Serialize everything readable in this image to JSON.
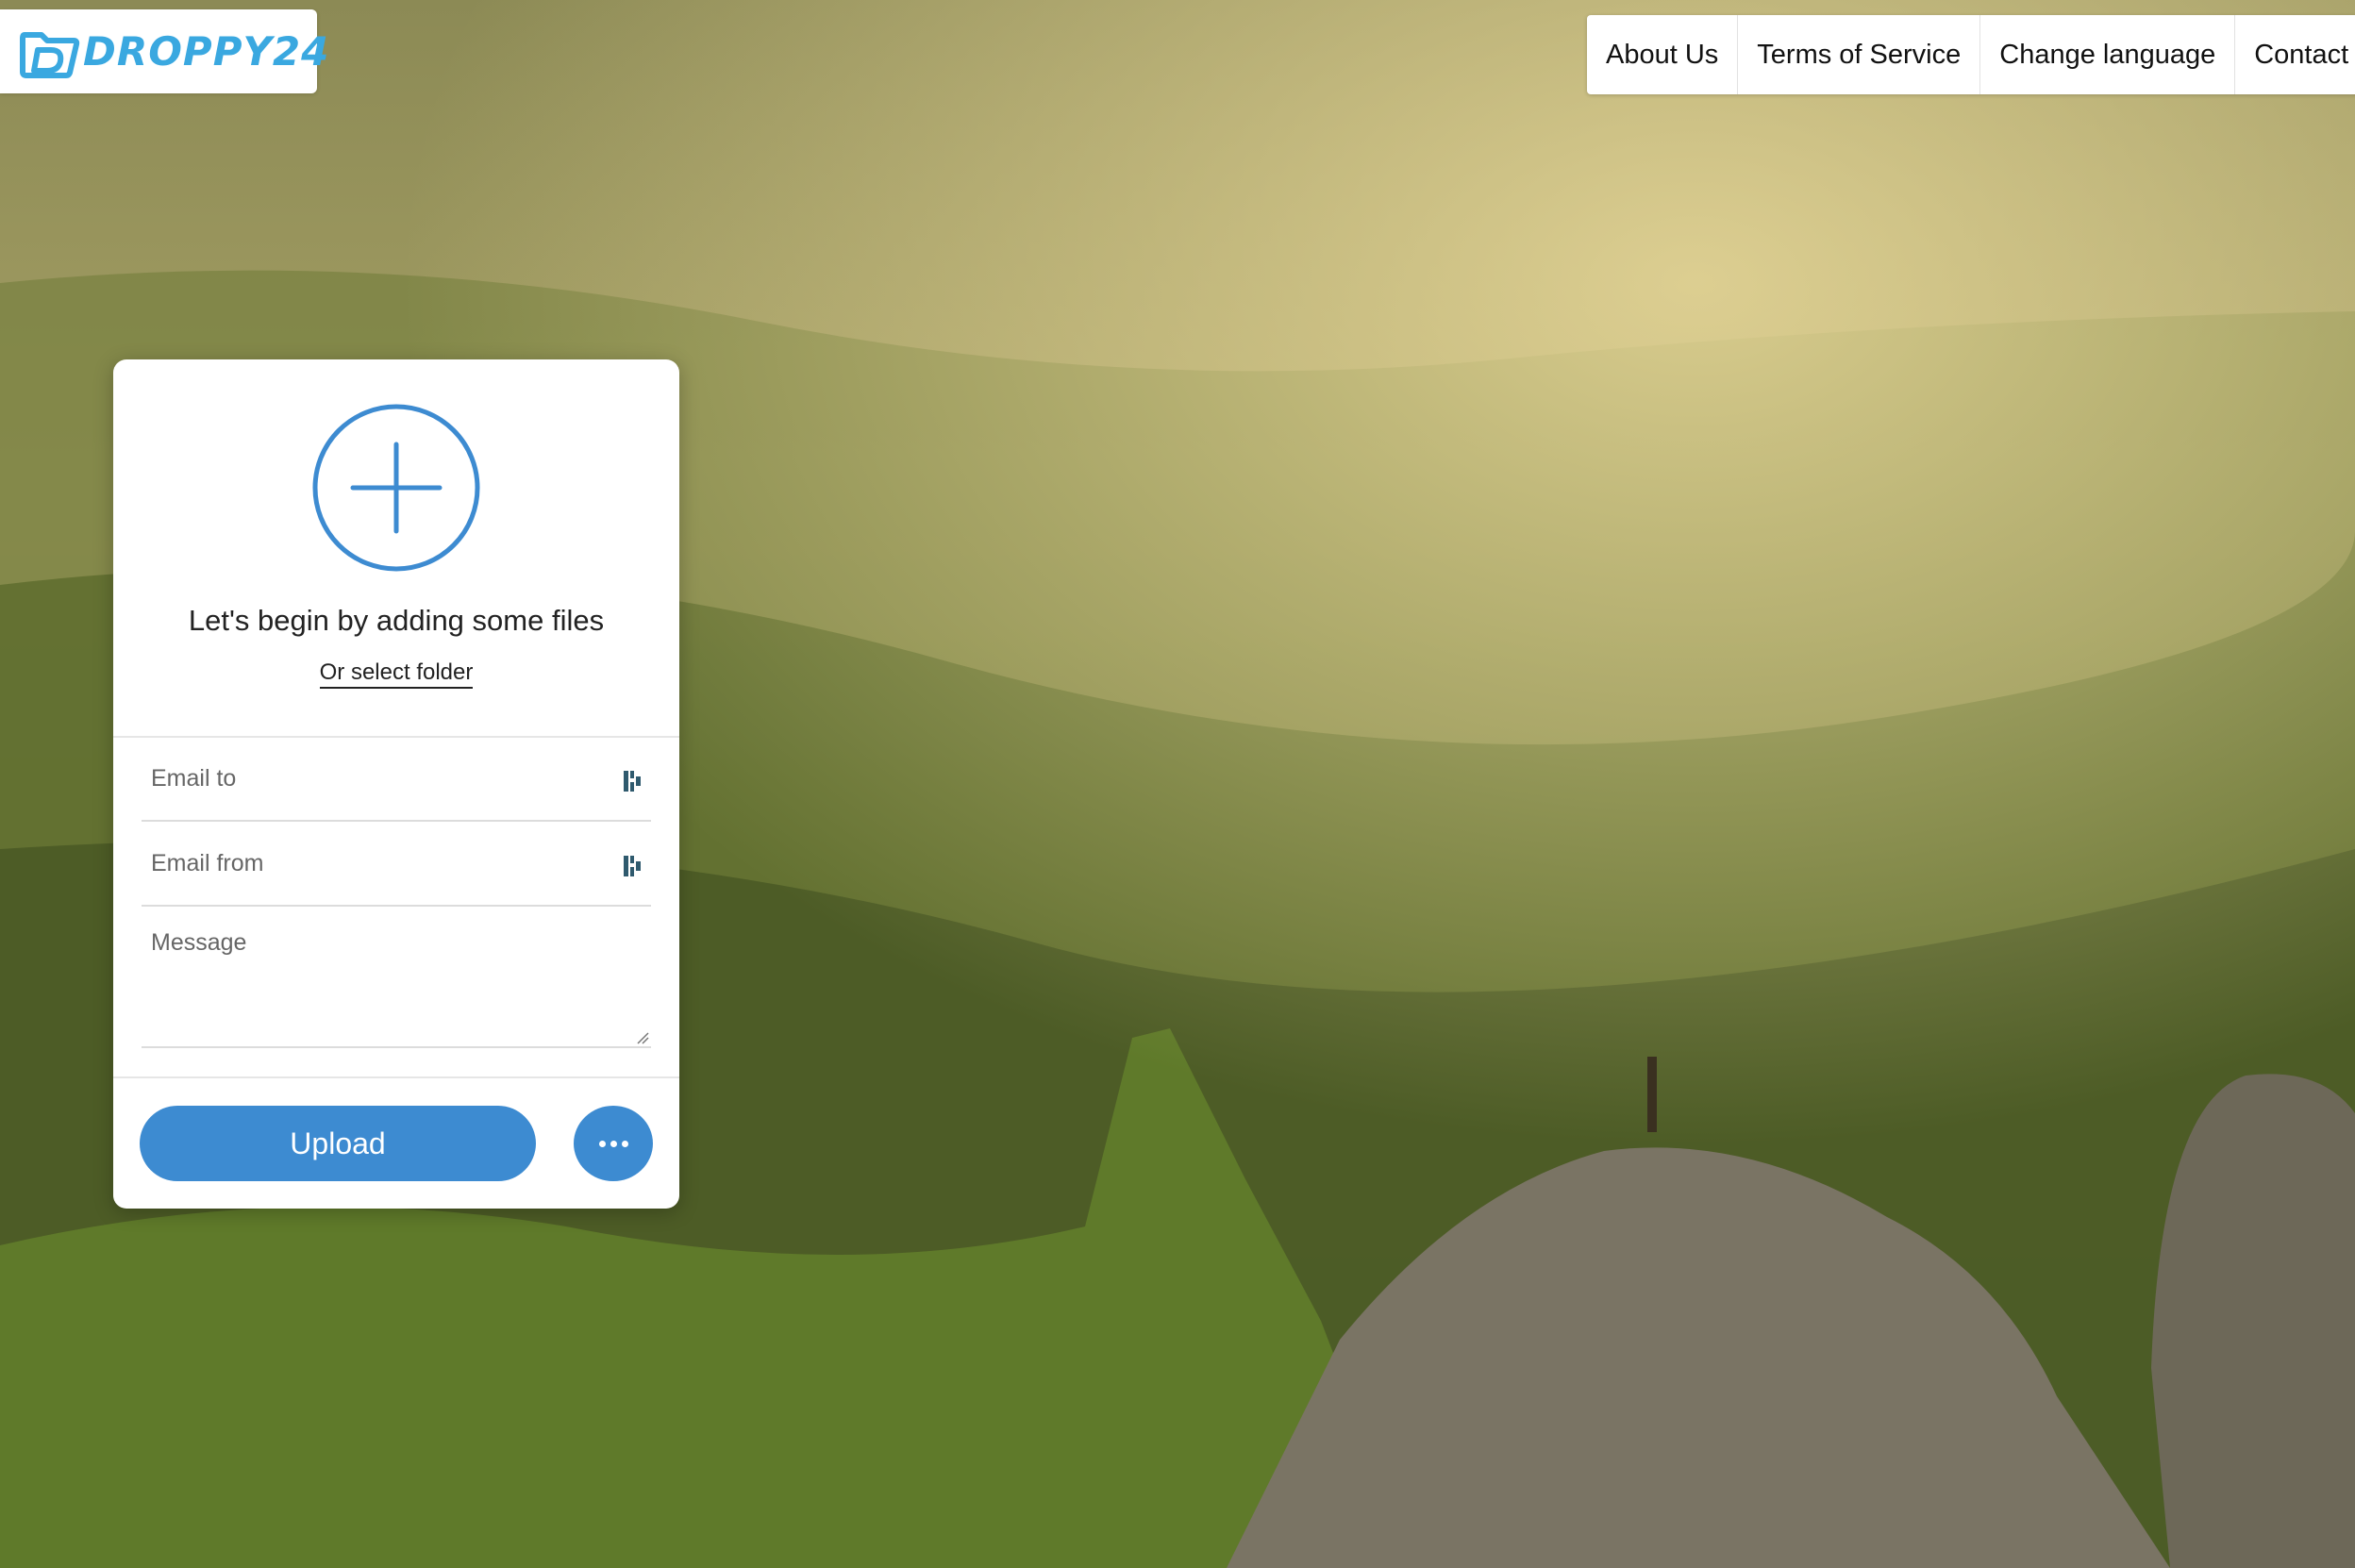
{
  "logo": {
    "text": "DROPPY24",
    "color": "#3aa8e0"
  },
  "nav": {
    "items": [
      {
        "label": "About Us"
      },
      {
        "label": "Terms of Service"
      },
      {
        "label": "Change language"
      },
      {
        "label": "Contact"
      }
    ]
  },
  "upload_card": {
    "add_icon": "plus-circle-icon",
    "title": "Let's begin by adding some files",
    "select_folder": "Or select folder",
    "email_to_placeholder": "Email to",
    "email_from_placeholder": "Email from",
    "message_placeholder": "Message",
    "field_icon": "password-manager-icon",
    "upload_label": "Upload",
    "more_icon": "more-horizontal-icon",
    "accent_color": "#3d8bd1"
  }
}
